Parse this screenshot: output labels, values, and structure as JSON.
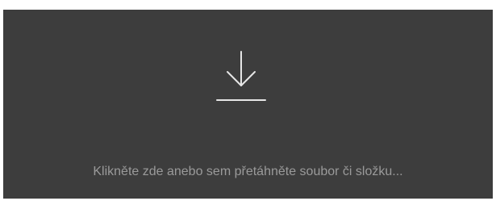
{
  "dropzone": {
    "icon": "download-icon",
    "label": "Klikněte zde anebo sem přetáhněte soubor či složku...",
    "colors": {
      "background": "#3d3d3d",
      "icon": "#e6e6e6",
      "text": "#9a9a9a"
    }
  }
}
